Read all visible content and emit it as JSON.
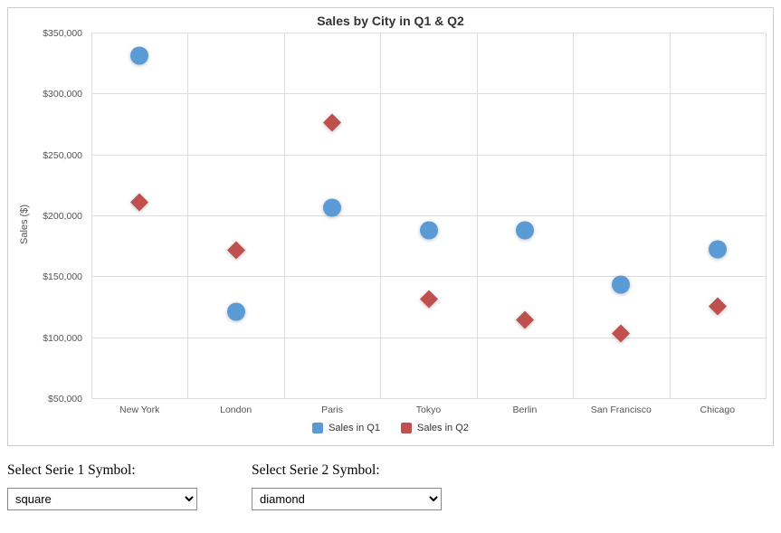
{
  "chart_data": {
    "type": "scatter",
    "title": "Sales by City in Q1 & Q2",
    "xlabel": "",
    "ylabel": "Sales ($)",
    "categories": [
      "New York",
      "London",
      "Paris",
      "Tokyo",
      "Berlin",
      "San Francisco",
      "Chicago"
    ],
    "series": [
      {
        "name": "Sales in Q1",
        "symbol": "circle",
        "color": "#5B9BD5",
        "values": [
          330000,
          120000,
          205000,
          187000,
          187000,
          142000,
          171000
        ]
      },
      {
        "name": "Sales in Q2",
        "symbol": "diamond",
        "color": "#C0504D",
        "values": [
          210000,
          170000,
          275000,
          130000,
          113000,
          102000,
          124000
        ]
      }
    ],
    "y_ticks": [
      "$50,000",
      "$100,000",
      "$150,000",
      "$200,000",
      "$250,000",
      "$300,000",
      "$350,000"
    ],
    "y_tick_values": [
      50000,
      100000,
      150000,
      200000,
      250000,
      300000,
      350000
    ],
    "ylim": [
      50000,
      350000
    ],
    "grid": true,
    "legend_position": "bottom"
  },
  "controls": {
    "serie1_label": "Select Serie 1 Symbol:",
    "serie2_label": "Select Serie 2 Symbol:",
    "serie1_value": "square",
    "serie2_value": "diamond"
  }
}
